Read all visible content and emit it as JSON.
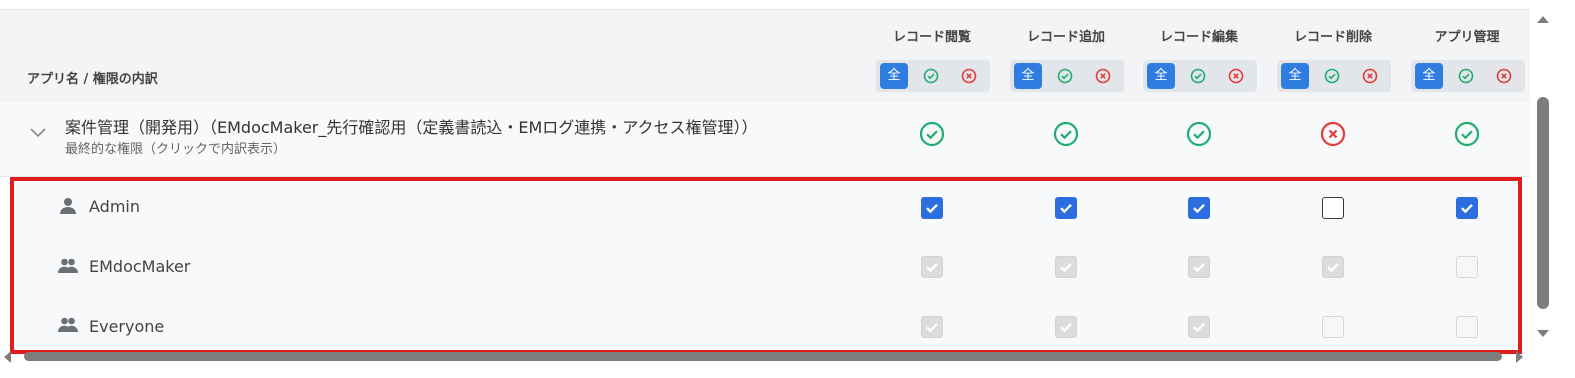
{
  "header": {
    "app_label": "アプリ名 / 権限の内訳",
    "columns": [
      {
        "title": "レコード閲覧",
        "all_label": "全"
      },
      {
        "title": "レコード追加",
        "all_label": "全"
      },
      {
        "title": "レコード編集",
        "all_label": "全"
      },
      {
        "title": "レコード削除",
        "all_label": "全"
      },
      {
        "title": "アプリ管理",
        "all_label": "全"
      }
    ]
  },
  "app": {
    "name": "案件管理（開発用）（EMdocMaker_先行確認用（定義書読込・EMログ連携・アクセス権管理））",
    "subtitle": "最終的な権限（クリックで内訳表示）",
    "final_permissions": [
      "allowed",
      "allowed",
      "allowed",
      "denied",
      "allowed"
    ]
  },
  "rows": [
    {
      "label": "Admin",
      "icon": "user-icon",
      "checks": [
        "on",
        "on",
        "on",
        "off",
        "on"
      ]
    },
    {
      "label": "EMdocMaker",
      "icon": "group-icon",
      "checks": [
        "dis-on",
        "dis-on",
        "dis-on",
        "dis-on",
        "dis-off"
      ]
    },
    {
      "label": "Everyone",
      "icon": "group-icon",
      "checks": [
        "dis-on",
        "dis-on",
        "dis-on",
        "dis-off",
        "dis-off"
      ]
    }
  ],
  "colors": {
    "accent": "#2f7de1",
    "allowed": "#1fae6f",
    "denied": "#e23b3b",
    "highlight": "#e01c1c"
  }
}
